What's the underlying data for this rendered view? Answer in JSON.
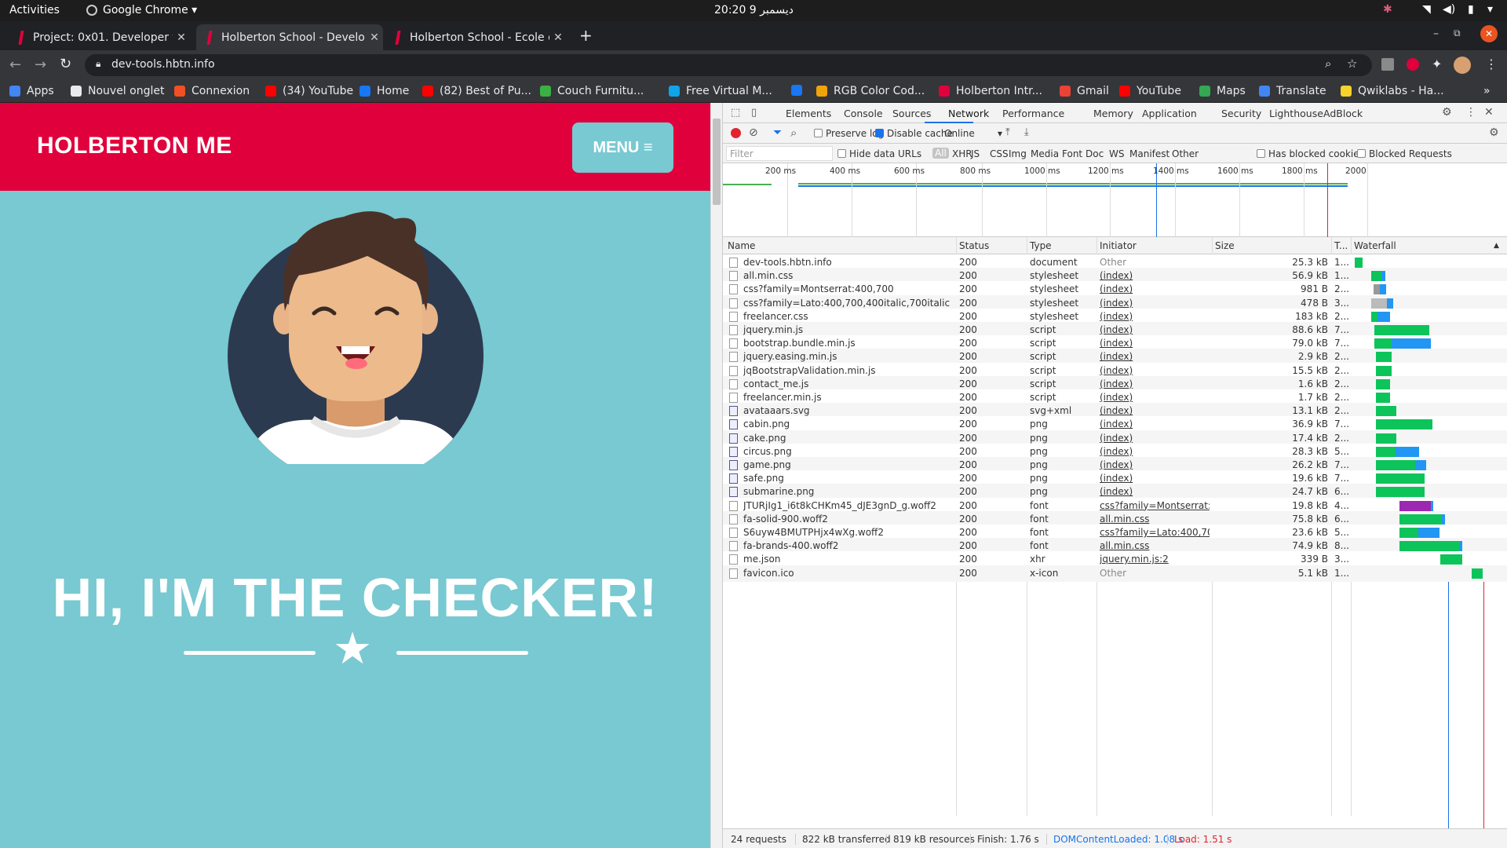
{
  "system": {
    "activities": "Activities",
    "app_name": "Google Chrome",
    "clock": "20:20 ديسمبر 9"
  },
  "tabs": [
    {
      "title": "Project: 0x01. Developer t",
      "active": false
    },
    {
      "title": "Holberton School - Develo",
      "active": true
    },
    {
      "title": "Holberton School - Ecole d",
      "active": false
    }
  ],
  "address": {
    "url": "dev-tools.hbtn.info"
  },
  "bookmarks": [
    {
      "label": "Apps",
      "icon": "apps-grid-icon",
      "color": "#4285f4"
    },
    {
      "label": "Nouvel onglet",
      "icon": "chrome-icon",
      "color": "#e8eaed"
    },
    {
      "label": "Connexion",
      "icon": "windows-icon",
      "color": "#f25022"
    },
    {
      "label": "(34) YouTube",
      "icon": "youtube-icon",
      "color": "#ff0000"
    },
    {
      "label": "Home",
      "icon": "facebook-icon",
      "color": "#1877f2"
    },
    {
      "label": "(82) Best of Pu...",
      "icon": "youtube-icon",
      "color": "#ff0000"
    },
    {
      "label": "Couch Furnitu...",
      "icon": "px-icon",
      "color": "#3bb143"
    },
    {
      "label": "Free Virtual M...",
      "icon": "edge-icon",
      "color": "#0ea5e9"
    },
    {
      "label": "",
      "icon": "facebook-icon",
      "color": "#1877f2"
    },
    {
      "label": "RGB Color Cod...",
      "icon": "r-icon",
      "color": "#f0a30a"
    },
    {
      "label": "Holberton Intr...",
      "icon": "holberton-icon",
      "color": "#e0003c"
    },
    {
      "label": "Gmail",
      "icon": "gmail-icon",
      "color": "#ea4335"
    },
    {
      "label": "YouTube",
      "icon": "youtube-icon",
      "color": "#ff0000"
    },
    {
      "label": "Maps",
      "icon": "maps-icon",
      "color": "#34a853"
    },
    {
      "label": "Translate",
      "icon": "translate-icon",
      "color": "#4285f4"
    },
    {
      "label": "Qwiklabs - Ha...",
      "icon": "qwiklabs-icon",
      "color": "#f6d32d"
    }
  ],
  "page": {
    "brand": "HOLBERTON ME",
    "menu_label": "MENU",
    "hero_title": "HI, I'M THE CHECKER!",
    "colors": {
      "header": "#e0003c",
      "background": "#78c9d1",
      "menu_button": "#78c9d1"
    }
  },
  "devtools": {
    "tabs": [
      "Elements",
      "Console",
      "Sources",
      "Network",
      "Performance",
      "Memory",
      "Application",
      "Security",
      "Lighthouse",
      "AdBlock"
    ],
    "active_tab": "Network",
    "toolbar": {
      "preserve_log": "Preserve log",
      "disable_cache": "Disable cache",
      "throttle": "Online"
    },
    "filter": {
      "placeholder": "Filter",
      "hide_data_urls": "Hide data URLs",
      "types": [
        "All",
        "XHR",
        "JS",
        "CSS",
        "Img",
        "Media",
        "Font",
        "Doc",
        "WS",
        "Manifest",
        "Other"
      ],
      "has_blocked_cookies": "Has blocked cookies",
      "blocked_requests": "Blocked Requests"
    },
    "overview_ticks": [
      "200 ms",
      "400 ms",
      "600 ms",
      "800 ms",
      "1000 ms",
      "1200 ms",
      "1400 ms",
      "1600 ms",
      "1800 ms",
      "2000"
    ],
    "columns": {
      "name": "Name",
      "status": "Status",
      "type": "Type",
      "initiator": "Initiator",
      "size": "Size",
      "time": "T...",
      "waterfall": "Waterfall"
    },
    "requests": [
      {
        "name": "dev-tools.hbtn.info",
        "status": "200",
        "type": "document",
        "initiator": "Other",
        "size": "25.3 kB",
        "time": "1...",
        "icon": "doc"
      },
      {
        "name": "all.min.css",
        "status": "200",
        "type": "stylesheet",
        "initiator": "(index)",
        "size": "56.9 kB",
        "time": "1...",
        "icon": "doc"
      },
      {
        "name": "css?family=Montserrat:400,700",
        "status": "200",
        "type": "stylesheet",
        "initiator": "(index)",
        "size": "981 B",
        "time": "2...",
        "icon": "doc"
      },
      {
        "name": "css?family=Lato:400,700,400italic,700italic",
        "status": "200",
        "type": "stylesheet",
        "initiator": "(index)",
        "size": "478 B",
        "time": "3...",
        "icon": "doc"
      },
      {
        "name": "freelancer.css",
        "status": "200",
        "type": "stylesheet",
        "initiator": "(index)",
        "size": "183 kB",
        "time": "2...",
        "icon": "doc"
      },
      {
        "name": "jquery.min.js",
        "status": "200",
        "type": "script",
        "initiator": "(index)",
        "size": "88.6 kB",
        "time": "7...",
        "icon": "doc"
      },
      {
        "name": "bootstrap.bundle.min.js",
        "status": "200",
        "type": "script",
        "initiator": "(index)",
        "size": "79.0 kB",
        "time": "7...",
        "icon": "doc"
      },
      {
        "name": "jquery.easing.min.js",
        "status": "200",
        "type": "script",
        "initiator": "(index)",
        "size": "2.9 kB",
        "time": "2...",
        "icon": "doc"
      },
      {
        "name": "jqBootstrapValidation.min.js",
        "status": "200",
        "type": "script",
        "initiator": "(index)",
        "size": "15.5 kB",
        "time": "2...",
        "icon": "doc"
      },
      {
        "name": "contact_me.js",
        "status": "200",
        "type": "script",
        "initiator": "(index)",
        "size": "1.6 kB",
        "time": "2...",
        "icon": "doc"
      },
      {
        "name": "freelancer.min.js",
        "status": "200",
        "type": "script",
        "initiator": "(index)",
        "size": "1.7 kB",
        "time": "2...",
        "icon": "doc"
      },
      {
        "name": "avataaars.svg",
        "status": "200",
        "type": "svg+xml",
        "initiator": "(index)",
        "size": "13.1 kB",
        "time": "2...",
        "icon": "img"
      },
      {
        "name": "cabin.png",
        "status": "200",
        "type": "png",
        "initiator": "(index)",
        "size": "36.9 kB",
        "time": "7...",
        "icon": "img"
      },
      {
        "name": "cake.png",
        "status": "200",
        "type": "png",
        "initiator": "(index)",
        "size": "17.4 kB",
        "time": "2...",
        "icon": "img"
      },
      {
        "name": "circus.png",
        "status": "200",
        "type": "png",
        "initiator": "(index)",
        "size": "28.3 kB",
        "time": "5...",
        "icon": "img"
      },
      {
        "name": "game.png",
        "status": "200",
        "type": "png",
        "initiator": "(index)",
        "size": "26.2 kB",
        "time": "7...",
        "icon": "img"
      },
      {
        "name": "safe.png",
        "status": "200",
        "type": "png",
        "initiator": "(index)",
        "size": "19.6 kB",
        "time": "7...",
        "icon": "img"
      },
      {
        "name": "submarine.png",
        "status": "200",
        "type": "png",
        "initiator": "(index)",
        "size": "24.7 kB",
        "time": "6...",
        "icon": "img"
      },
      {
        "name": "JTURjIg1_i6t8kCHKm45_dJE3gnD_g.woff2",
        "status": "200",
        "type": "font",
        "initiator": "css?family=Montserrat:...",
        "size": "19.8 kB",
        "time": "4...",
        "icon": "doc"
      },
      {
        "name": "fa-solid-900.woff2",
        "status": "200",
        "type": "font",
        "initiator": "all.min.css",
        "size": "75.8 kB",
        "time": "6...",
        "icon": "doc"
      },
      {
        "name": "S6uyw4BMUTPHjx4wXg.woff2",
        "status": "200",
        "type": "font",
        "initiator": "css?family=Lato:400,70...",
        "size": "23.6 kB",
        "time": "5...",
        "icon": "doc"
      },
      {
        "name": "fa-brands-400.woff2",
        "status": "200",
        "type": "font",
        "initiator": "all.min.css",
        "size": "74.9 kB",
        "time": "8...",
        "icon": "doc"
      },
      {
        "name": "me.json",
        "status": "200",
        "type": "xhr",
        "initiator": "jquery.min.js:2",
        "size": "339 B",
        "time": "3...",
        "icon": "doc"
      },
      {
        "name": "favicon.ico",
        "status": "200",
        "type": "x-icon",
        "initiator": "Other",
        "size": "5.1 kB",
        "time": "1...",
        "icon": "doc"
      }
    ],
    "footer": {
      "requests": "24 requests",
      "transferred": "822 kB transferred",
      "resources": "819 kB resources",
      "finish": "Finish: 1.76 s",
      "dcl": "DOMContentLoaded: 1.08 s",
      "load": "Load: 1.51 s"
    }
  }
}
